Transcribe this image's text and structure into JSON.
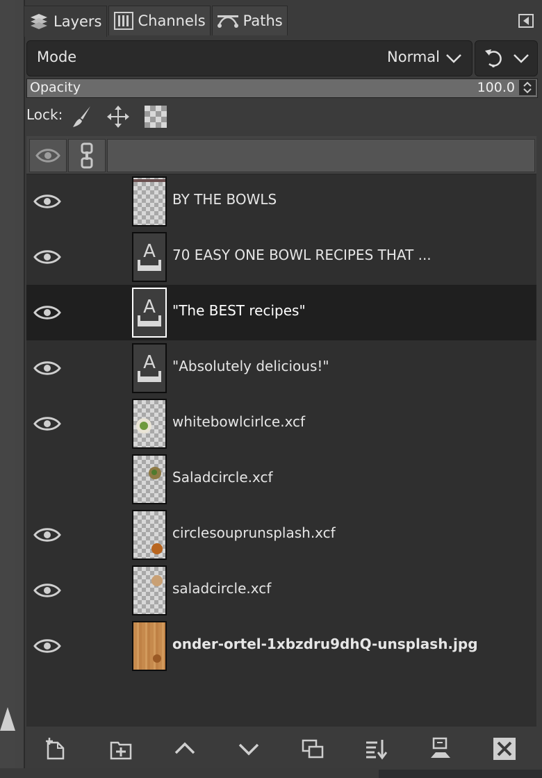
{
  "tabs": [
    {
      "label": "Layers",
      "icon": "layers-icon",
      "active": true
    },
    {
      "label": "Channels",
      "icon": "channels-icon",
      "active": false
    },
    {
      "label": "Paths",
      "icon": "paths-icon",
      "active": false
    }
  ],
  "mode": {
    "label": "Mode",
    "value": "Normal"
  },
  "opacity": {
    "label": "Opacity",
    "value": "100.0"
  },
  "lock": {
    "label": "Lock:",
    "icons": [
      "lock-pixels-icon",
      "lock-position-icon",
      "lock-alpha-icon"
    ]
  },
  "layers": [
    {
      "name": "BY THE BOWLS",
      "visible": true,
      "thumb": "transparent",
      "selected": false,
      "bold": false
    },
    {
      "name": "70 EASY ONE BOWL RECIPES THAT ...",
      "visible": true,
      "thumb": "text",
      "selected": false,
      "bold": false
    },
    {
      "name": "\"The BEST recipes\"",
      "visible": true,
      "thumb": "text",
      "selected": true,
      "bold": false
    },
    {
      "name": "\"Absolutely delicious!\"",
      "visible": true,
      "thumb": "text",
      "selected": false,
      "bold": false
    },
    {
      "name": "whitebowlcirlce.xcf",
      "visible": true,
      "thumb": "image",
      "selected": false,
      "bold": false
    },
    {
      "name": "Saladcircle.xcf",
      "visible": false,
      "thumb": "image",
      "selected": false,
      "bold": false
    },
    {
      "name": "circlesouprunsplash.xcf",
      "visible": true,
      "thumb": "image",
      "selected": false,
      "bold": false
    },
    {
      "name": "saladcircle.xcf",
      "visible": true,
      "thumb": "image",
      "selected": false,
      "bold": false
    },
    {
      "name": "onder-ortel-1xbzdru9dhQ-unsplash.jpg",
      "visible": true,
      "thumb": "wood",
      "selected": false,
      "bold": true
    }
  ],
  "toolbar": [
    "new-layer-icon",
    "new-layer-group-icon",
    "raise-layer-icon",
    "lower-layer-icon",
    "duplicate-layer-icon",
    "merge-down-icon",
    "anchor-layer-icon",
    "delete-layer-icon"
  ],
  "colors": {
    "panel_bg": "#3b3b3b",
    "list_bg": "#2f2f2f",
    "selected_row": "#1f1f1f",
    "text": "#e6e6e6"
  }
}
